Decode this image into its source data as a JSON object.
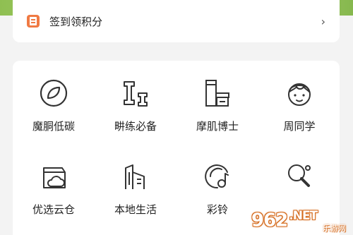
{
  "checkin": {
    "label": "签到领积分",
    "icon": "checkin-doc-icon",
    "chevron": "›"
  },
  "services": [
    {
      "label": "魔胴低碳",
      "icon": "leaf-circle-icon"
    },
    {
      "label": "畊练必备",
      "icon": "dumbbell-icon"
    },
    {
      "label": "摩肌博士",
      "icon": "skincare-bottle-icon"
    },
    {
      "label": "周同学",
      "icon": "student-face-icon"
    },
    {
      "label": "优选云仓",
      "icon": "cloud-box-icon"
    },
    {
      "label": "本地生活",
      "icon": "buildings-icon"
    },
    {
      "label": "彩铃",
      "icon": "music-note-icon"
    },
    {
      "label": "",
      "icon": "ping-pong-icon"
    }
  ],
  "watermark": {
    "logo": "962",
    "suffix": ".NET",
    "sub": "乐游网"
  },
  "colors": {
    "accent": "#f07a43",
    "icon_stroke": "#333333"
  }
}
